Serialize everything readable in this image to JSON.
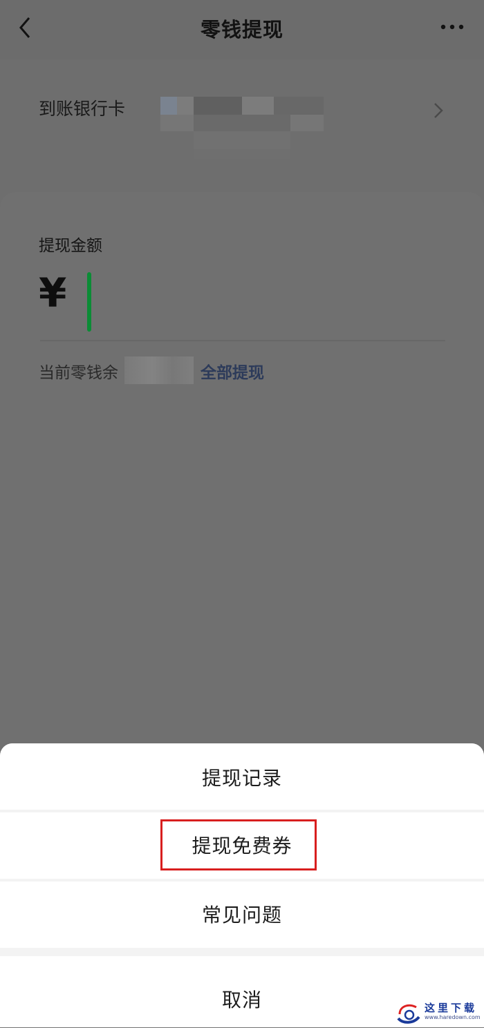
{
  "navbar": {
    "title": "零钱提现",
    "back_icon": "chevron-left-icon",
    "more_icon": "more-dots-icon"
  },
  "bank": {
    "label": "到账银行卡",
    "chevron_icon": "chevron-right-icon"
  },
  "amount": {
    "label": "提现金额",
    "currency_symbol": "¥",
    "value": ""
  },
  "balance": {
    "prefix": "当前零钱余",
    "withdraw_all": "全部提现"
  },
  "action_sheet": {
    "items": [
      {
        "label": "提现记录"
      },
      {
        "label": "提现免费券"
      },
      {
        "label": "常见问题"
      }
    ],
    "cancel": "取消"
  },
  "colors": {
    "cursor": "#0b8c35",
    "highlight": "#d81e1e",
    "link": "#2d3b5a"
  },
  "watermark": {
    "text": "这里下载",
    "url": "www.haredown.com"
  }
}
